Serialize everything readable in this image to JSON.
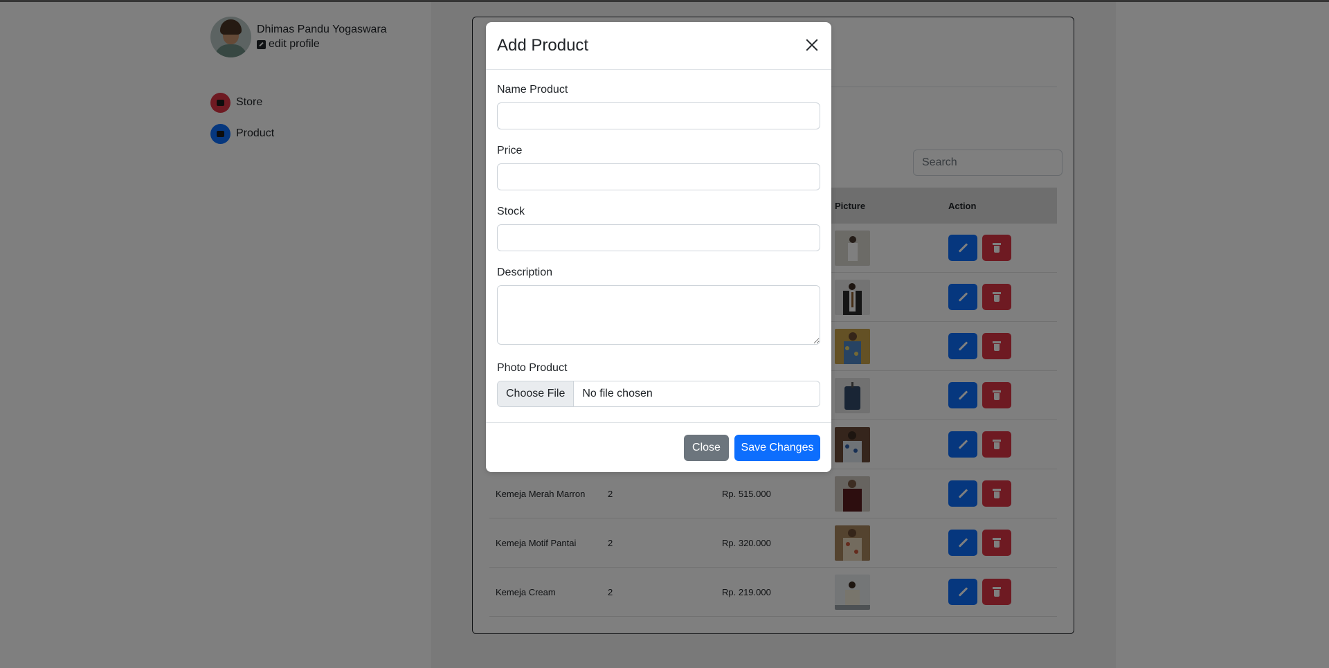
{
  "profile": {
    "name": "Dhimas Pandu Yogaswara",
    "edit_label": "edit profile"
  },
  "sidebar": {
    "items": [
      {
        "label": "Store"
      },
      {
        "label": "Product"
      }
    ]
  },
  "search": {
    "placeholder": "Search"
  },
  "table": {
    "headers": [
      "",
      "",
      "",
      "Picture",
      "Action"
    ],
    "rows": [
      {
        "name": "",
        "qty": "",
        "price": ""
      },
      {
        "name": "",
        "qty": "",
        "price": ""
      },
      {
        "name": "",
        "qty": "",
        "price": ""
      },
      {
        "name": "",
        "qty": "",
        "price": ""
      },
      {
        "name": "",
        "qty": "",
        "price": ""
      },
      {
        "name": "Kemeja Merah Marron",
        "qty": "2",
        "price": "Rp. 515.000"
      },
      {
        "name": "Kemeja Motif Pantai",
        "qty": "2",
        "price": "Rp. 320.000"
      },
      {
        "name": "Kemeja Cream",
        "qty": "2",
        "price": "Rp. 219.000"
      }
    ]
  },
  "modal": {
    "title": "Add Product",
    "labels": {
      "name": "Name Product",
      "price": "Price",
      "stock": "Stock",
      "description": "Description",
      "photo": "Photo Product"
    },
    "file": {
      "button": "Choose File",
      "status": "No file chosen"
    },
    "buttons": {
      "close": "Close",
      "save": "Save Changes"
    }
  },
  "colors": {
    "primary": "#0d6efd",
    "danger": "#dc3545",
    "secondary": "#6c757d"
  },
  "icons": [
    "store-icon",
    "product-icon",
    "edit-profile-icon",
    "close-icon",
    "pencil-icon",
    "trash-icon"
  ]
}
